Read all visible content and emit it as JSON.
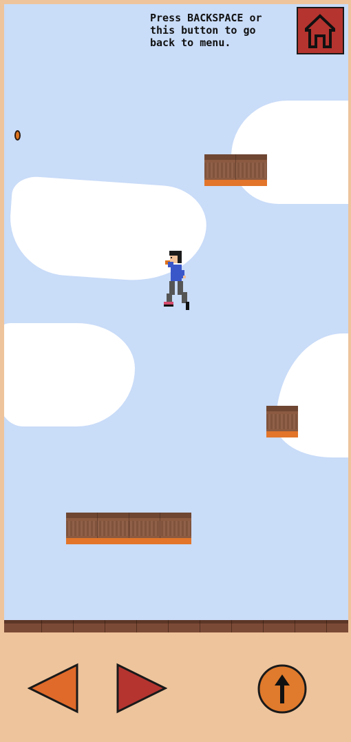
{
  "header": {
    "instructions": "Press BACKSPACE or\nthis button to go\nback to menu."
  },
  "buttons": {
    "home": {
      "icon": "home-icon"
    },
    "left": {
      "icon": "arrow-left-icon"
    },
    "right": {
      "icon": "arrow-right-icon"
    },
    "jump": {
      "icon": "arrow-up-icon"
    }
  },
  "colors": {
    "sky": "#c9dcf8",
    "frame": "#eec49c",
    "home_button": "#b5342f",
    "left_arrow": "#e06a2a",
    "right_arrow": "#b5342f",
    "jump_button": "#e07a2c"
  }
}
